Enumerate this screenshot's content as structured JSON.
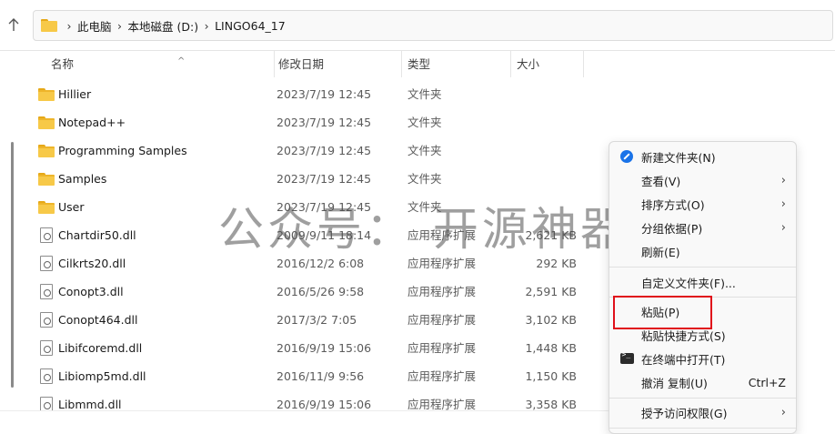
{
  "address": {
    "crumbs": [
      "此电脑",
      "本地磁盘 (D:)",
      "LINGO64_17"
    ]
  },
  "columns": {
    "name": "名称",
    "date": "修改日期",
    "type": "类型",
    "size": "大小"
  },
  "files": [
    {
      "name": "Hillier",
      "date": "2023/7/19 12:45",
      "type": "文件夹",
      "size": "",
      "kind": "folder"
    },
    {
      "name": "Notepad++",
      "date": "2023/7/19 12:45",
      "type": "文件夹",
      "size": "",
      "kind": "folder"
    },
    {
      "name": "Programming Samples",
      "date": "2023/7/19 12:45",
      "type": "文件夹",
      "size": "",
      "kind": "folder"
    },
    {
      "name": "Samples",
      "date": "2023/7/19 12:45",
      "type": "文件夹",
      "size": "",
      "kind": "folder"
    },
    {
      "name": "User",
      "date": "2023/7/19 12:45",
      "type": "文件夹",
      "size": "",
      "kind": "folder"
    },
    {
      "name": "Chartdir50.dll",
      "date": "2009/9/11 18:14",
      "type": "应用程序扩展",
      "size": "2,621 KB",
      "kind": "dll"
    },
    {
      "name": "Cilkrts20.dll",
      "date": "2016/12/2 6:08",
      "type": "应用程序扩展",
      "size": "292 KB",
      "kind": "dll"
    },
    {
      "name": "Conopt3.dll",
      "date": "2016/5/26 9:58",
      "type": "应用程序扩展",
      "size": "2,591 KB",
      "kind": "dll"
    },
    {
      "name": "Conopt464.dll",
      "date": "2017/3/2 7:05",
      "type": "应用程序扩展",
      "size": "3,102 KB",
      "kind": "dll"
    },
    {
      "name": "Libifcoremd.dll",
      "date": "2016/9/19 15:06",
      "type": "应用程序扩展",
      "size": "1,448 KB",
      "kind": "dll"
    },
    {
      "name": "Libiomp5md.dll",
      "date": "2016/11/9 9:56",
      "type": "应用程序扩展",
      "size": "1,150 KB",
      "kind": "dll"
    },
    {
      "name": "Libmmd.dll",
      "date": "2016/9/19 15:06",
      "type": "应用程序扩展",
      "size": "3,358 KB",
      "kind": "dll"
    }
  ],
  "context_menu": {
    "new_folder": "新建文件夹(N)",
    "view": "查看(V)",
    "sort": "排序方式(O)",
    "group": "分组依据(P)",
    "refresh": "刷新(E)",
    "customize": "自定义文件夹(F)...",
    "paste": "粘贴(P)",
    "paste_shortcut": "粘贴快捷方式(S)",
    "open_terminal": "在终端中打开(T)",
    "undo": "撤消 复制(U)",
    "undo_shortcut": "Ctrl+Z",
    "access": "授予访问权限(G)"
  },
  "watermark": "公众号： 开源神器",
  "colors": {
    "folder": "#f7c948",
    "accent_blue": "#1a73e8",
    "highlight_red": "#e0101a"
  }
}
